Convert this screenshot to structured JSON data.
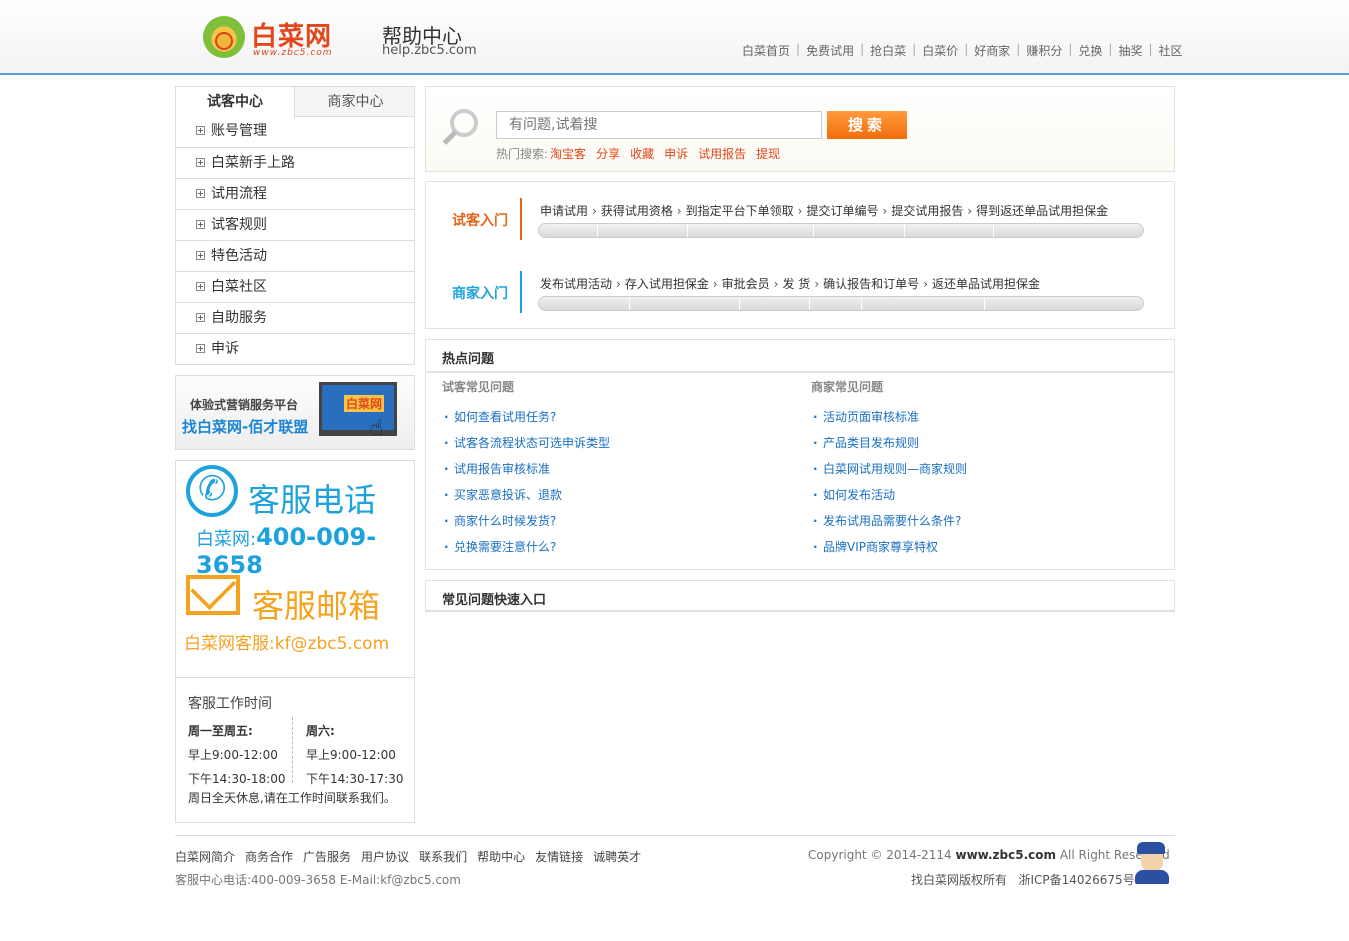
{
  "header": {
    "logo_text": "白菜网",
    "logo_url": "www.zbc5.com",
    "help_title": "帮助中心",
    "help_url": "help.zbc5.com",
    "nav": [
      "白菜首页",
      "免费试用",
      "抢白菜",
      "白菜价",
      "好商家",
      "赚积分",
      "兑换",
      "抽奖",
      "社区"
    ]
  },
  "sidebar": {
    "tabs": [
      "试客中心",
      "商家中心"
    ],
    "menu": [
      "账号管理",
      "白菜新手上路",
      "试用流程",
      "试客规则",
      "特色活动",
      "白菜社区",
      "自助服务",
      "申诉"
    ],
    "banner": {
      "line1": "体验式营销服务平台",
      "line2": "找白菜网-佰才联盟",
      "screen_logo": "白菜网"
    },
    "service": {
      "phone_title": "客服电话",
      "phone_prefix": "白菜网:",
      "phone_number": "400-009-3658",
      "mail_title": "客服邮箱",
      "mail_addr": "白菜网客服:kf@zbc5.com",
      "hours_title": "客服工作时间",
      "weekday_label": "周一至周五:",
      "weekday_am": "早上9:00-12:00",
      "weekday_pm": "下午14:30-18:00",
      "sat_label": "周六:",
      "sat_am": "早上9:00-12:00",
      "sat_pm": "下午14:30-17:30",
      "note": "周日全天休息,请在工作时间联系我们。"
    }
  },
  "search": {
    "placeholder": "有问题,试着搜",
    "button": "搜索",
    "hot_label": "热门搜索:",
    "hot_keywords": [
      "淘宝客",
      "分享",
      "收藏",
      "申诉",
      "试用报告",
      "提现"
    ]
  },
  "flow": {
    "trial_label": "试客入门",
    "trial_steps": [
      "申请试用",
      "获得试用资格",
      "到指定平台下单领取",
      "提交订单编号",
      "提交试用报告",
      "得到返还单品试用担保金"
    ],
    "merchant_label": "商家入门",
    "merchant_steps": [
      "发布试用活动",
      "存入试用担保金",
      "审批会员",
      "发 货",
      "确认报告和订单号",
      "返还单品试用担保金"
    ]
  },
  "hot": {
    "title": "热点问题",
    "left_title": "试客常见问题",
    "left_links": [
      "如何查看试用任务?",
      "试客各流程状态可选申诉类型",
      "试用报告审核标准",
      "买家恶意投诉、退款",
      "商家什么时候发货?",
      "兑换需要注意什么?"
    ],
    "right_title": "商家常见问题",
    "right_links": [
      "活动页面审核标准",
      "产品类目发布规则",
      "白菜网试用规则—商家规则",
      "如何发布活动",
      "发布试用品需要什么条件?",
      "品牌VIP商家尊享特权"
    ]
  },
  "quick": {
    "title": "常见问题快速入口"
  },
  "footer": {
    "links": [
      "白菜网简介",
      "商务合作",
      "广告服务",
      "用户协议",
      "联系我们",
      "帮助中心",
      "友情链接",
      "诚聘英才"
    ],
    "contact": "客服中心电话:400-009-3658 E-Mail:kf@zbc5.com",
    "copyright_pre": "Copyright © 2014-2114 ",
    "copyright_site": "www.zbc5.com",
    "copyright_post": " All Right Reserved",
    "icp": "找白菜网版权所有   浙ICP备14026675号"
  },
  "colors": {
    "accent_blue": "#1ea2de",
    "accent_orange": "#e5651a",
    "link": "#1a6fc0"
  }
}
